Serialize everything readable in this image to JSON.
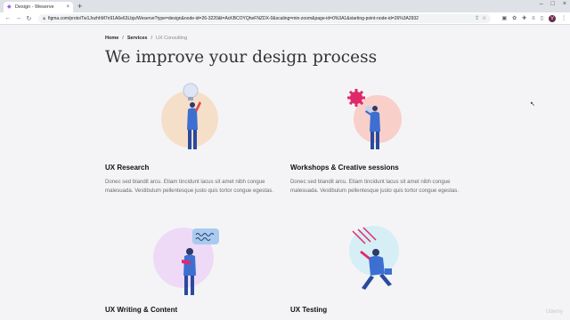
{
  "browser": {
    "tab_title": "Design - Weserve",
    "favicon": "figma-icon",
    "new_tab": "+",
    "url": "figma.com/proto/Tw1JozhhM7n91A6e63Lbjs/Weserve?type=design&node-id=26-3220&t=AcKBCOYQheFNZDX-0&scaling=min-zoom&page-id=0%3A1&starting-point-node-id=26%3A2932"
  },
  "breadcrumb": {
    "home": "Home",
    "services": "Services",
    "current": "UX Consulting",
    "separator": "/"
  },
  "page_title": "We improve your design process",
  "cards": [
    {
      "heading": "UX Research",
      "desc": "Donec sed blandit arcu. Etiam tincidunt lacus sit amet nibh congue malesuada. Vestibulum pellentesque justo quis tortor congue egestas.",
      "circle_color": "#f6dfc8"
    },
    {
      "heading": "Workshops & Creative sessions",
      "desc": "Donec sed blandit arcu. Etiam tincidunt lacus sit amet nibh congue malesuada. Vestibulum pellentesque justo quis tortor congue egestas.",
      "circle_color": "#f8cfc9"
    },
    {
      "heading": "UX Writing & Content",
      "desc": "",
      "circle_color": "#eedaf6"
    },
    {
      "heading": "UX Testing",
      "desc": "",
      "circle_color": "#d6eef5"
    }
  ],
  "watermark": "Udemy"
}
